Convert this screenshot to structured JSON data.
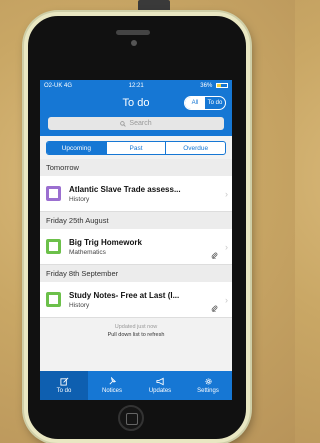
{
  "status_bar": {
    "carrier": "O2-UK",
    "network": "4G",
    "time": "12:21",
    "battery": "36%",
    "battery_level": 0.36
  },
  "navbar": {
    "title": "To do",
    "toggle_all": "All",
    "toggle_todo": "To do"
  },
  "search": {
    "placeholder": "Search"
  },
  "filter_tabs": [
    {
      "label": "Upcoming",
      "active": true
    },
    {
      "label": "Past",
      "active": false
    },
    {
      "label": "Overdue",
      "active": false
    }
  ],
  "sections": [
    {
      "header": "Tomorrow",
      "items": [
        {
          "title": "Atlantic Slave Trade assess...",
          "subject": "History",
          "color": "#9b6fd0",
          "attachment": false
        }
      ]
    },
    {
      "header": "Friday 25th August",
      "items": [
        {
          "title": "Big Trig Homework",
          "subject": "Mathematics",
          "color": "#6cc04a",
          "attachment": true
        }
      ]
    },
    {
      "header": "Friday 8th September",
      "items": [
        {
          "title": "Study Notes- Free at Last (l...",
          "subject": "History",
          "color": "#6cc04a",
          "attachment": true
        }
      ]
    }
  ],
  "refresh": {
    "updated": "Updated just now",
    "hint": "Pull down list to refresh"
  },
  "tabbar": [
    {
      "label": "To do",
      "icon": "edit-icon",
      "active": true
    },
    {
      "label": "Notices",
      "icon": "pin-icon",
      "active": false
    },
    {
      "label": "Updates",
      "icon": "megaphone-icon",
      "active": false
    },
    {
      "label": "Settings",
      "icon": "gear-icon",
      "active": false
    }
  ],
  "colors": {
    "accent": "#1677d4"
  }
}
